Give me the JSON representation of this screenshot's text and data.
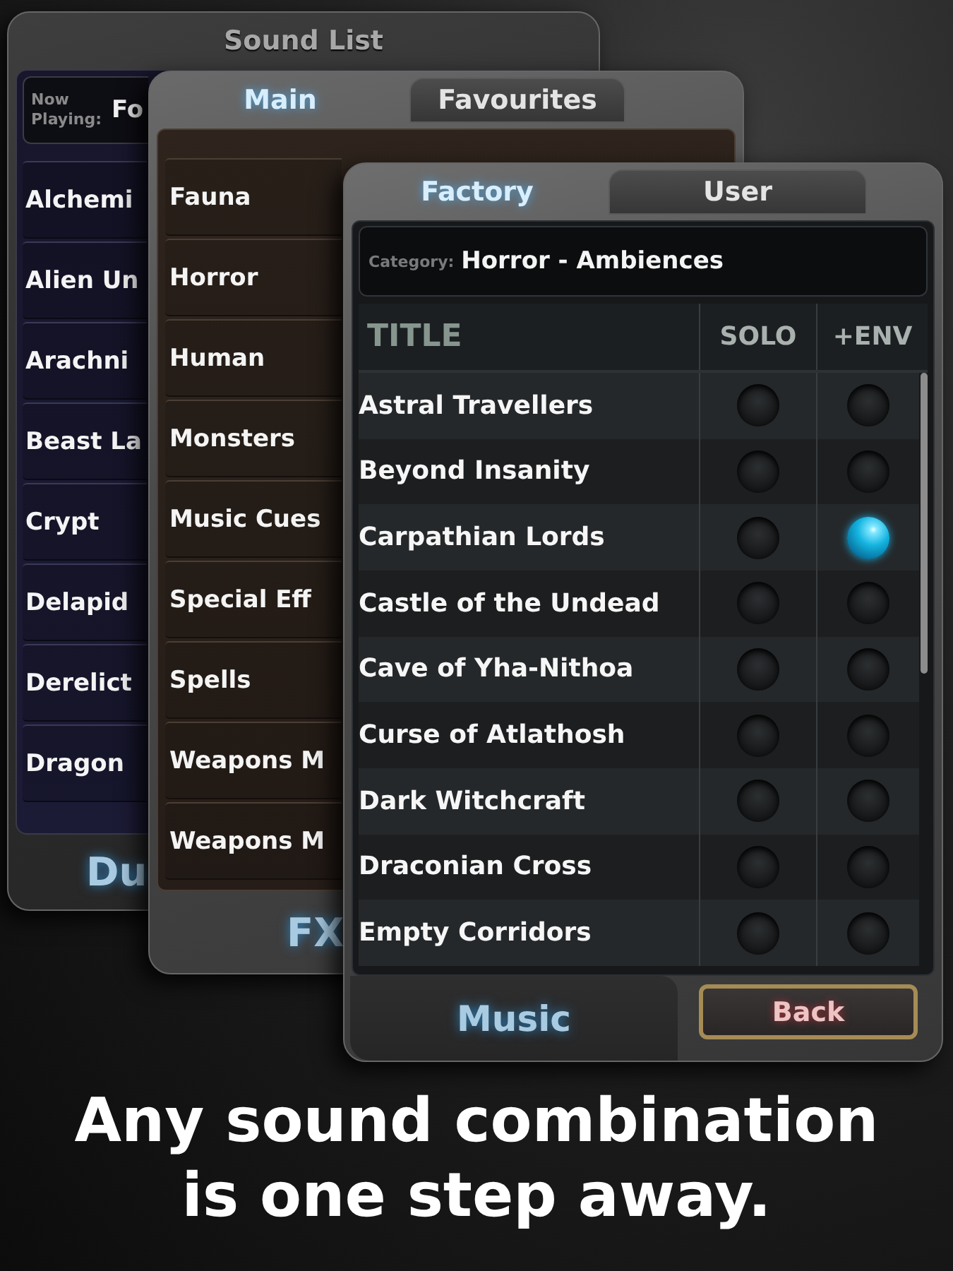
{
  "sound_list_panel": {
    "title": "Sound List",
    "now_playing": {
      "label": "Now Playing:",
      "value": "Fo"
    },
    "items": [
      "Alchemi",
      "Alien Un",
      "Arachni",
      "Beast La",
      "Crypt",
      "Delapid",
      "Derelict",
      "Dragon"
    ],
    "footer_label": "Du"
  },
  "category_panel": {
    "tabs": [
      {
        "label": "Main",
        "selected": true
      },
      {
        "label": "Favourites",
        "selected": false
      }
    ],
    "items": [
      "Fauna",
      "Horror",
      "Human",
      "Monsters",
      "Music Cues",
      "Special Eff",
      "Spells",
      "Weapons M",
      "Weapons M"
    ],
    "footer_label": "FX"
  },
  "track_panel": {
    "tabs": [
      {
        "label": "Factory",
        "selected": true
      },
      {
        "label": "User",
        "selected": false
      }
    ],
    "category": {
      "label": "Category:",
      "value": "Horror - Ambiences"
    },
    "table": {
      "columns": [
        "TITLE",
        "SOLO",
        "+ENV"
      ],
      "rows": [
        {
          "title": "Astral Travellers",
          "solo": false,
          "env": false
        },
        {
          "title": "Beyond Insanity",
          "solo": false,
          "env": false
        },
        {
          "title": "Carpathian Lords",
          "solo": false,
          "env": true
        },
        {
          "title": "Castle of the Undead",
          "solo": false,
          "env": false
        },
        {
          "title": "Cave of Yha-Nithoa",
          "solo": false,
          "env": false
        },
        {
          "title": "Curse of Atlathosh",
          "solo": false,
          "env": false
        },
        {
          "title": "Dark Witchcraft",
          "solo": false,
          "env": false
        },
        {
          "title": "Draconian Cross",
          "solo": false,
          "env": false
        },
        {
          "title": "Empty Corridors",
          "solo": false,
          "env": false
        }
      ]
    },
    "footer_label": "Music",
    "back_button": "Back"
  },
  "caption": "Any sound combination is one step away."
}
